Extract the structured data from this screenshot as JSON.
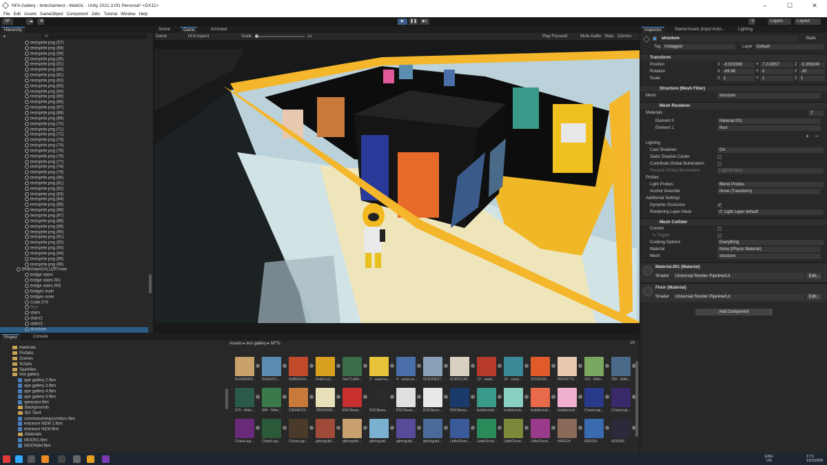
{
  "window": {
    "title": "NFA Gallery - bnbchaintest - WebGL - Unity 2021.3.0f1 Personal* <DX11>"
  },
  "menu": [
    "File",
    "Edit",
    "Assets",
    "GameObject",
    "Component",
    "Jobs",
    "Tutorial",
    "Window",
    "Help"
  ],
  "toolbar": {
    "account": "SF",
    "layers": "Layers",
    "layout": "Layout"
  },
  "hierarchy": {
    "tab": "Hierarchy",
    "search_placeholder": "All",
    "items": [
      "testsprite.png (57)",
      "testsprite.png (58)",
      "testsprite.png (59)",
      "testsprite.png (30)",
      "testsprite.png (31)",
      "testsprite.png (60)",
      "testsprite.png (61)",
      "testsprite.png (62)",
      "testsprite.png (63)",
      "testsprite.png (64)",
      "testsprite.png (65)",
      "testsprite.png (66)",
      "testsprite.png (67)",
      "testsprite.png (68)",
      "testsprite.png (69)",
      "testsprite.png (70)",
      "testsprite.png (71)",
      "testsprite.png (72)",
      "testsprite.png (73)",
      "testsprite.png (74)",
      "testsprite.png (75)",
      "testsprite.png (76)",
      "testsprite.png (77)",
      "testsprite.png (78)",
      "testsprite.png (79)",
      "testsprite.png (80)",
      "testsprite.png (81)",
      "testsprite.png (82)",
      "testsprite.png (83)",
      "testsprite.png (84)",
      "testsprite.png (85)",
      "testsprite.png (86)",
      "testsprite.png (87)",
      "testsprite.png (88)",
      "testsprite.png (89)",
      "testsprite.png (90)",
      "testsprite.png (91)",
      "testsprite.png (92)",
      "testsprite.png (93)",
      "testsprite.png (94)",
      "testsprite.png (95)",
      "testsprite.png (96)",
      "BNBchainGALLERYnew",
      "bridge stairs",
      "bridge stairs.001",
      "bridge stairs.003",
      "bridges main",
      "bridges outer",
      "Cube.074",
      "floor",
      "stairs",
      "stairs2",
      "stairs3",
      "structure"
    ]
  },
  "scene_tabs": {
    "scene": "Scene",
    "game": "Game",
    "animator": "Animator"
  },
  "game_bar": {
    "display": "Game",
    "aspect": "16:9 Aspect",
    "scale_label": "Scale",
    "scale_value": "1x",
    "play_focused": "Play Focused",
    "mute": "Mute Audio",
    "stats": "Stats",
    "gizmos": "Gizmos"
  },
  "inspector": {
    "tabs": [
      "Inspector",
      "StarterAssets (Input Actio...",
      "Lighting"
    ],
    "object_name": "structure",
    "static": "Static",
    "tag_label": "Tag",
    "tag": "Untagged",
    "layer_label": "Layer",
    "layer": "Default",
    "transform": {
      "title": "Transform",
      "position_label": "Position",
      "rotation_label": "Rotation",
      "scale_label": "Scale",
      "position": [
        "-6.501568",
        "7.213657",
        "-5.356249"
      ],
      "rotation": [
        "-89.98",
        "0",
        "-30"
      ],
      "scale": [
        "1",
        "1",
        "1"
      ]
    },
    "mesh_filter": {
      "title": "Structure (Mesh Filter)",
      "mesh_label": "Mesh",
      "mesh": "structure"
    },
    "mesh_renderer": {
      "title": "Mesh Renderer",
      "materials_label": "Materials",
      "materials_count": "2",
      "element0_label": "Element 0",
      "element0": "Material.001",
      "element1_label": "Element 1",
      "element1": "floor",
      "lighting": "Lighting",
      "cast_shadows_label": "Cast Shadows",
      "cast_shadows": "On",
      "static_shadow": "Static Shadow Caster",
      "contribute_gi": "Contribute Global Illumination",
      "receive_gi_label": "Receive Global Illumination",
      "receive_gi": "Light Probes",
      "probes": "Probes",
      "light_probes_label": "Light Probes",
      "light_probes": "Blend Probes",
      "anchor_label": "Anchor Override",
      "anchor": "None (Transform)",
      "additional": "Additional Settings",
      "dyn_occ": "Dynamic Occlusion",
      "rlm_label": "Rendering Layer Mask",
      "rlm": "0: Light Layer default"
    },
    "mesh_collider": {
      "title": "Mesh Collider",
      "convex": "Convex",
      "trigger": "Is Trigger",
      "cooking_label": "Cooking Options",
      "cooking": "Everything",
      "material_label": "Material",
      "material": "None (Physic Material)",
      "mesh_label": "Mesh",
      "mesh": "structure"
    },
    "materials": [
      {
        "name": "Material.001 (Material)",
        "shader_label": "Shader",
        "shader": "Universal Render Pipeline/Lit",
        "edit": "Edit..."
      },
      {
        "name": "Floor (Material)",
        "shader_label": "Shader",
        "shader": "Universal Render Pipeline/Lit",
        "edit": "Edit..."
      }
    ],
    "add_component": "Add Component"
  },
  "project": {
    "tabs": [
      "Project",
      "Console"
    ],
    "breadcrumb": [
      "Assets",
      "test gallery",
      "NFTs"
    ],
    "count": "19",
    "tree": [
      "Materials",
      "Prefabs",
      "Scenes",
      "Scripts",
      "Sparklies",
      "test gallery",
      "ape gallery 2.fbm",
      "ape gallery 3.fbm",
      "ape gallery 4.fbm",
      "ape gallery 5.fbm",
      "apewater.fbm",
      "Backgrounds",
      "BG Tier4",
      "commonchimpcorridors.fbm",
      "entrance NEW 1.fbm",
      "entrance NEW.fbm",
      "Materials",
      "MOON1.fbm",
      "MOONdef.fbm"
    ],
    "assets": [
      {
        "label": "0x1b9b009...",
        "color": "#c9a16b"
      },
      {
        "label": "0x9eb37c...",
        "color": "#5b8db0"
      },
      {
        "label": "0xB60a7ef...",
        "color": "#c04a2a"
      },
      {
        "label": "0xa0cca1...",
        "color": "#d9a020"
      },
      {
        "label": "0xe71a5fe...",
        "color": "#3a6e4a"
      },
      {
        "label": "3 - saad sa...",
        "color": "#e7c33a"
      },
      {
        "label": "4 - saad sa...",
        "color": "#4a6fa8"
      },
      {
        "label": "5CE0DE57...",
        "color": "#8aa0b8"
      },
      {
        "label": "5C8F5CAF...",
        "color": "#d8d0c0"
      },
      {
        "label": "12 - saad...",
        "color": "#b83a2a"
      },
      {
        "label": "14 - saad...",
        "color": "#3a8a9a"
      },
      {
        "label": "32CED03...",
        "color": "#e05a2a"
      },
      {
        "label": "60C64772...",
        "color": "#e8c8b0"
      },
      {
        "label": "162 - Mike...",
        "color": "#7aa860"
      },
      {
        "label": "265 - Mike...",
        "color": "#4a6a8a"
      },
      {
        "label": "675 - Mike...",
        "color": "#2a5a4a"
      },
      {
        "label": "845 - Mike...",
        "color": "#3a7a4a"
      },
      {
        "label": "13549FC0...",
        "color": "#c87a3a"
      },
      {
        "label": "7f8942900...",
        "color": "#e8e0b8"
      },
      {
        "label": "BSCNews...",
        "color": "#c83030"
      },
      {
        "label": "BSCNews...",
        "color": "#2a2a2a"
      },
      {
        "label": "BSCNews...",
        "color": "#e0e0e0"
      },
      {
        "label": "BSCNews...",
        "color": "#e8e8e8"
      },
      {
        "label": "BSCNews...",
        "color": "#1a3a6a"
      },
      {
        "label": "bubbleclub...",
        "color": "#3a9a8a"
      },
      {
        "label": "bubbleclub...",
        "color": "#8ad0c0"
      },
      {
        "label": "bubbleclub...",
        "color": "#e86a4a"
      },
      {
        "label": "bubbleclub...",
        "color": "#f0b0d0"
      },
      {
        "label": "ChainLegi...",
        "color": "#2a3a8a"
      },
      {
        "label": "ChainLegi...",
        "color": "#3a2a6a"
      },
      {
        "label": "ChainLegi...",
        "color": "#6a2a7a"
      },
      {
        "label": "ChainLegi...",
        "color": "#2a5a3a"
      },
      {
        "label": "ChainLegi...",
        "color": "#4a3a2a"
      },
      {
        "label": "glitchguild...",
        "color": "#a04a3a"
      },
      {
        "label": "glitchguild...",
        "color": "#c8a070"
      },
      {
        "label": "glitchguild...",
        "color": "#7ab0d0"
      },
      {
        "label": "glitchguild...",
        "color": "#5a4a9a"
      },
      {
        "label": "glitchguild...",
        "color": "#4a6a9a"
      },
      {
        "label": "LittleGhost...",
        "color": "#3a5a9a"
      },
      {
        "label": "LittleGhost...",
        "color": "#2a8a5a"
      },
      {
        "label": "LittleGhost...",
        "color": "#7a8a3a"
      },
      {
        "label": "LittleGhost...",
        "color": "#9a3a8a"
      },
      {
        "label": "NFA224",
        "color": "#8a6a5a"
      },
      {
        "label": "NFA253",
        "color": "#3a6ab0"
      },
      {
        "label": "NFA369",
        "color": "#2a2a3a"
      }
    ]
  },
  "taskbar": {
    "time": "17:0",
    "date": "13/12/202",
    "lang": "ENG",
    "region": "US"
  }
}
